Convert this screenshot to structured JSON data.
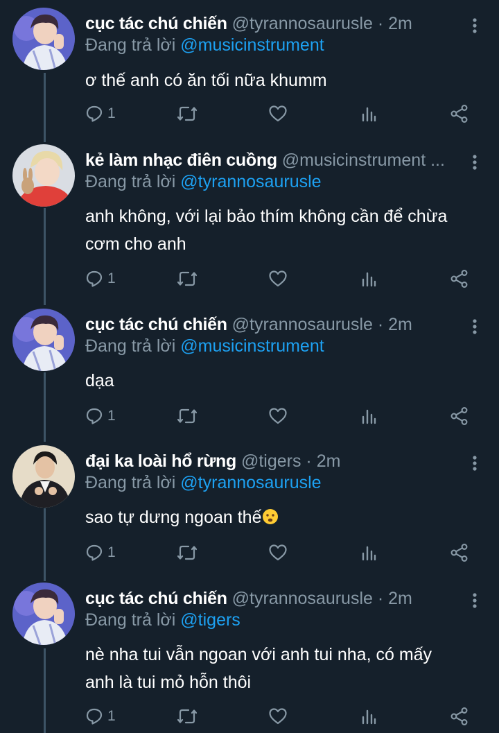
{
  "thread": {
    "tweets": [
      {
        "display_name": "cục tác chú chiến",
        "handle": "@tyrannosaurusle",
        "dot": "·",
        "time": "2m",
        "reply_prefix": "Đang trả lời",
        "reply_to": "@musicinstrument",
        "body": "ơ thế anh có ăn tối nữa khumm",
        "reply_count": "1"
      },
      {
        "display_name": "kẻ làm nhạc điên cuồng",
        "handle": "@musicinstrument ...",
        "dot": "",
        "time": "",
        "reply_prefix": "Đang trả lời",
        "reply_to": "@tyrannosaurusle",
        "body_line1": "anh không, với lại bảo thím không cần để chừa",
        "body_line2": "cơm cho anh",
        "reply_count": "1"
      },
      {
        "display_name": "cục tác chú chiến",
        "handle": "@tyrannosaurusle",
        "dot": "·",
        "time": "2m",
        "reply_prefix": "Đang trả lời",
        "reply_to": "@musicinstrument",
        "body": "dạa",
        "reply_count": "1"
      },
      {
        "display_name": "đại ka loài hổ rừng",
        "handle": "@tigers",
        "dot": "·",
        "time": "2m",
        "reply_prefix": "Đang trả lời",
        "reply_to": "@tyrannosaurusle",
        "body": "sao tự dưng ngoan thế",
        "emoji": "frowning-face-emoji",
        "reply_count": "1"
      },
      {
        "display_name": "cục tác chú chiến",
        "handle": "@tyrannosaurusle",
        "dot": "·",
        "time": "2m",
        "reply_prefix": "Đang trả lời",
        "reply_to": "@tigers",
        "body_line1": "nè nha tui vẫn ngoan với anh tui nha, có mấy",
        "body_line2": "anh là tui mỏ hỗn thôi",
        "reply_count": "1"
      }
    ]
  },
  "colors": {
    "background": "#15202b",
    "text_primary": "#ffffff",
    "text_secondary": "#8899a6",
    "link": "#1da1f2",
    "thread_line": "#3d5466"
  },
  "icons": {
    "reply": "reply-icon",
    "retweet": "retweet-icon",
    "like": "heart-icon",
    "analytics": "analytics-icon",
    "share": "share-icon",
    "more": "more-vertical-icon"
  }
}
